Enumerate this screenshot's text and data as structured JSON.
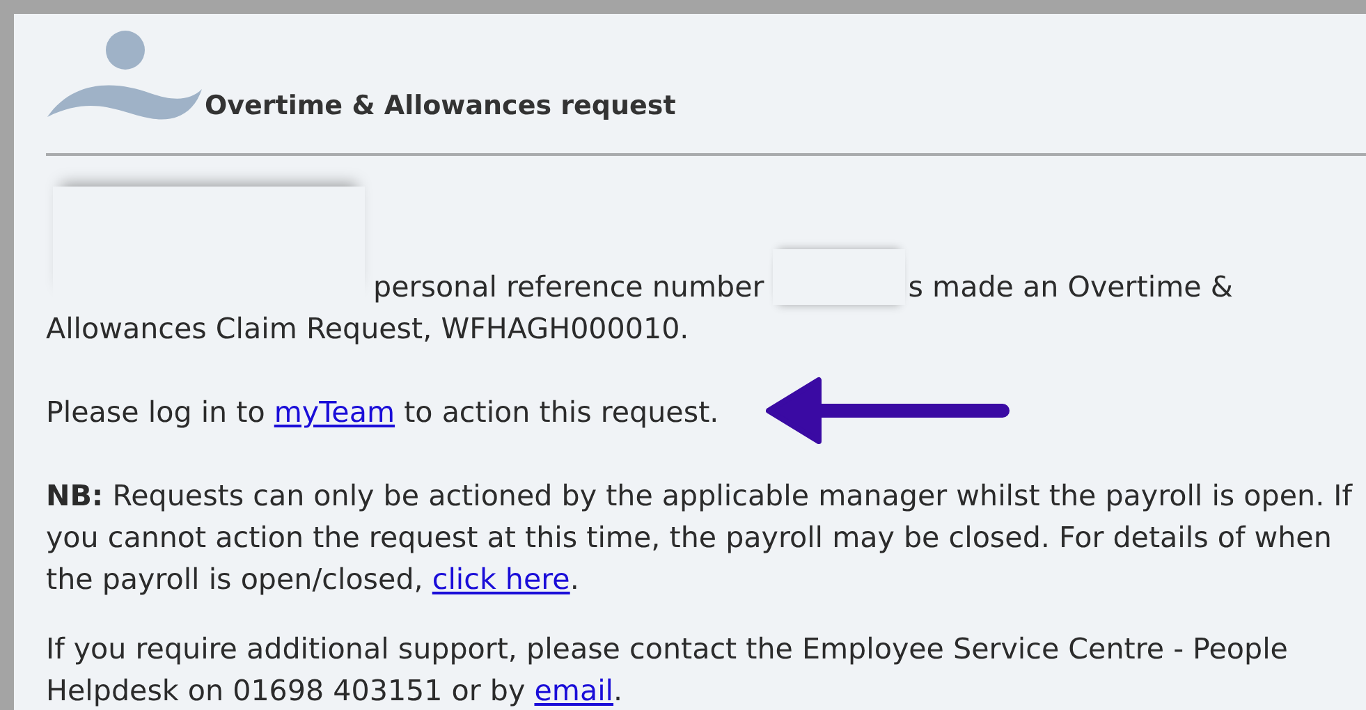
{
  "header": {
    "title": "Overtime & Allowances request"
  },
  "paragraphs": [
    {
      "parts": [
        {
          "kind": "redaction",
          "wide": true
        },
        {
          "kind": "text",
          "text": "personal reference number "
        },
        {
          "kind": "redaction",
          "wide": false
        },
        {
          "kind": "text",
          "text": "s made an Overtime &\nAllowances Claim Request, WFHAGH000010."
        }
      ]
    },
    {
      "parts": [
        {
          "kind": "text",
          "text": "Please log in to "
        },
        {
          "kind": "link",
          "text": "myTeam"
        },
        {
          "kind": "text",
          "text": " to action this request."
        }
      ],
      "arrow": true
    },
    {
      "parts": [
        {
          "kind": "text",
          "text": "**NB:** Requests can only be actioned by the applicable manager whilst the payroll is open. If\nyou cannot action the request at this time, the payroll may be closed. For details of when\nthe payroll is open/closed, "
        },
        {
          "kind": "link",
          "text": "click here"
        },
        {
          "kind": "text",
          "text": "."
        }
      ]
    },
    {
      "parts": [
        {
          "kind": "text",
          "text": "If you require additional support, please contact the Employee Service Centre - People\nHelpdesk on 01698 403151 or by "
        },
        {
          "kind": "link",
          "text": "email"
        },
        {
          "kind": "text",
          "text": "."
        }
      ]
    }
  ]
}
